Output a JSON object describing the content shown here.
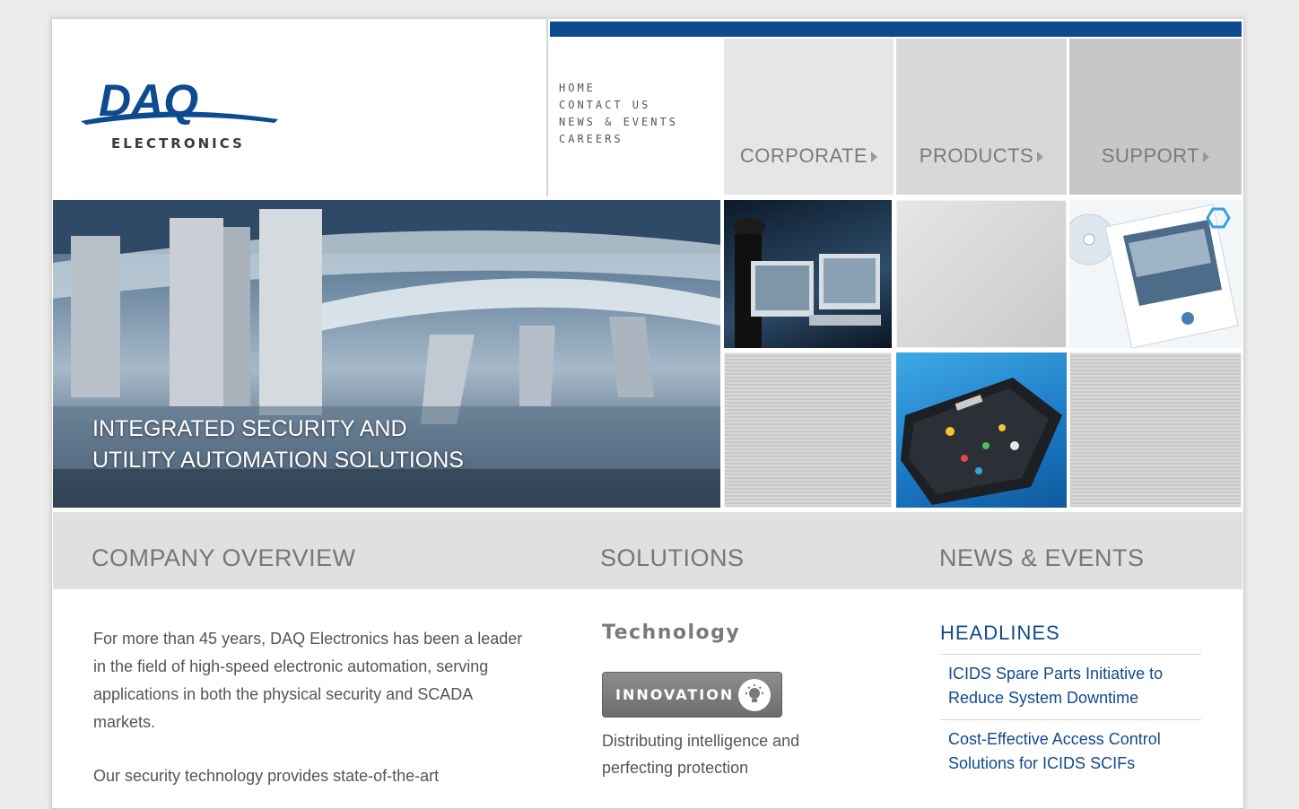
{
  "brand": {
    "logo_letters": "DAQ",
    "logo_subtitle": "ELECTRONICS",
    "primary_color": "#114a8c",
    "strip_color": "#0d4a8f"
  },
  "quick_links": [
    "HOME",
    "CONTACT US",
    "NEWS & EVENTS",
    "CAREERS"
  ],
  "nav": {
    "corporate": "CORPORATE",
    "products": "PRODUCTS",
    "support": "SUPPORT"
  },
  "hero": {
    "line1": "INTEGRATED SECURITY AND",
    "line2": "UTILITY AUTOMATION SOLUTIONS"
  },
  "sections": {
    "overview": "COMPANY OVERVIEW",
    "solutions": "SOLUTIONS",
    "news": "NEWS & EVENTS"
  },
  "overview": {
    "para1": "For more than 45 years, DAQ Electronics has been a leader in the field of high-speed electronic automation, serving applications in both the physical security and SCADA markets.",
    "para2": "Our security technology provides state-of-the-art"
  },
  "solutions": {
    "title": "Technology",
    "button_label": "INNOVATION",
    "description": "Distributing intelligence and perfecting protection"
  },
  "news": {
    "headlines_title": "HEADLINES",
    "items": [
      "ICIDS Spare Parts Initiative to Reduce System Downtime",
      "Cost-Effective Access Control Solutions for ICIDS SCIFs"
    ]
  }
}
